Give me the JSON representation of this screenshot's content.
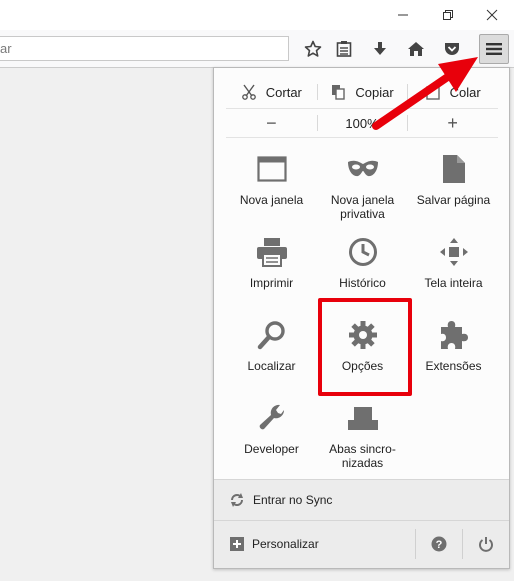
{
  "urlbar": {
    "placeholder": "ar"
  },
  "edit": {
    "cut": "Cortar",
    "copy": "Copiar",
    "paste": "Colar"
  },
  "zoom": {
    "minus": "−",
    "level": "100%",
    "plus": "+"
  },
  "menu_items": [
    {
      "label": "Nova janela",
      "icon": "window-icon"
    },
    {
      "label": "Nova janela\nprivativa",
      "icon": "mask-icon"
    },
    {
      "label": "Salvar página",
      "icon": "document-icon"
    },
    {
      "label": "Imprimir",
      "icon": "printer-icon"
    },
    {
      "label": "Histórico",
      "icon": "clock-icon"
    },
    {
      "label": "Tela inteira",
      "icon": "fullscreen-icon"
    },
    {
      "label": "Localizar",
      "icon": "magnifier-icon"
    },
    {
      "label": "Opções",
      "icon": "gear-icon"
    },
    {
      "label": "Extensões",
      "icon": "puzzle-icon"
    },
    {
      "label": "Developer",
      "icon": "wrench-icon"
    },
    {
      "label": "Abas sincro-\nnizadas",
      "icon": "synced-tabs-icon"
    }
  ],
  "footer": {
    "sync": "Entrar no Sync",
    "customize": "Personalizar"
  },
  "colors": {
    "accent_red": "#e8000b",
    "icon_gray": "#6f6f6f"
  }
}
